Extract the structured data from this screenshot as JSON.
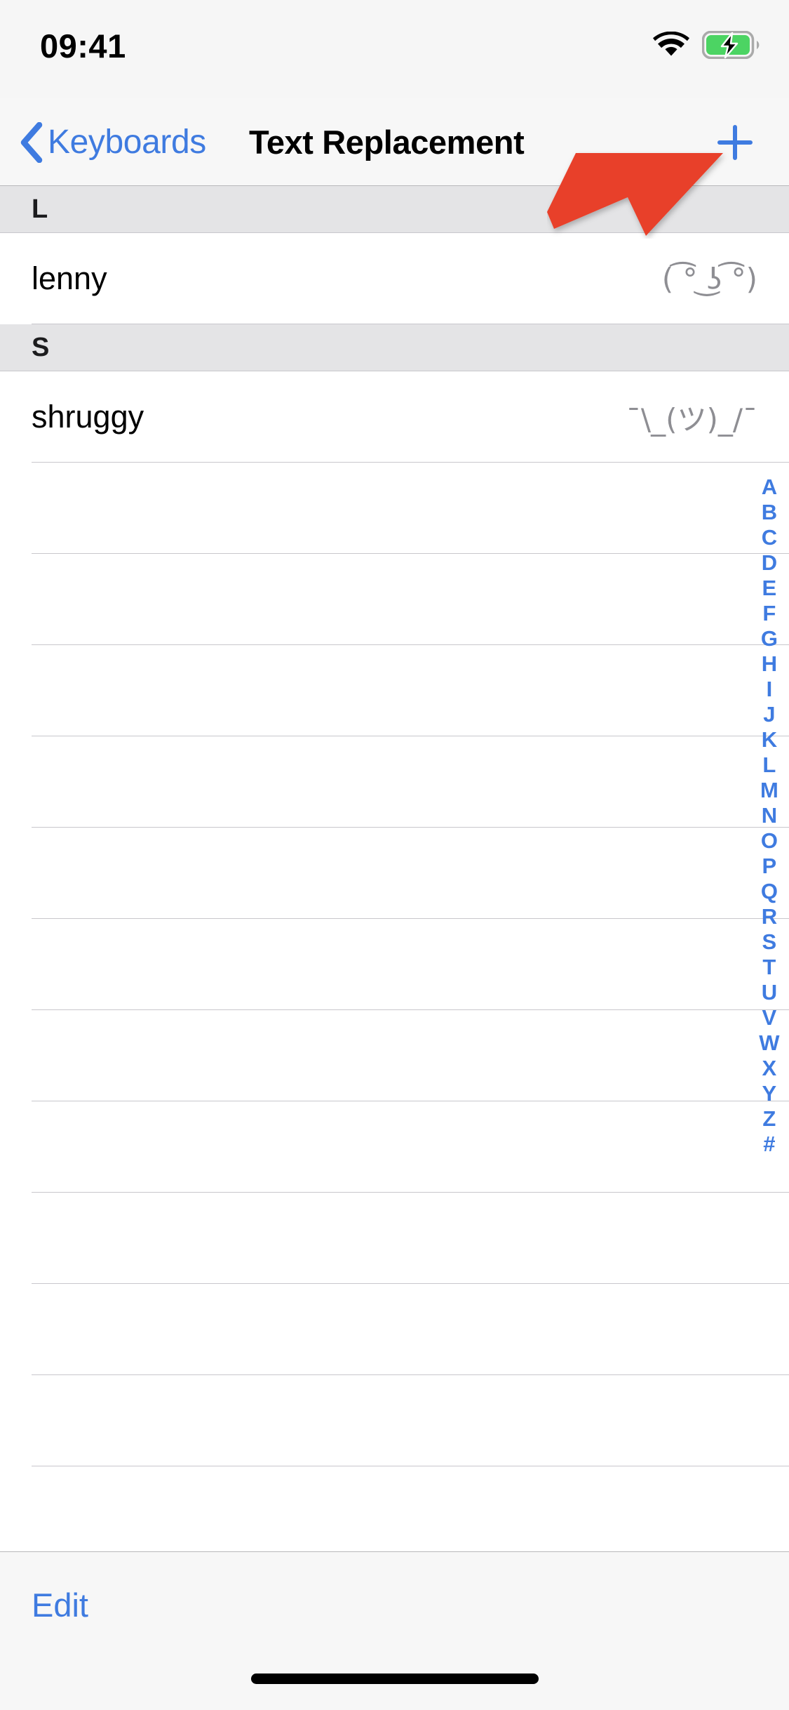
{
  "status_bar": {
    "time": "09:41",
    "wifi_icon": "wifi-icon",
    "battery_icon": "battery-charging-icon",
    "battery_color": "#4CD463"
  },
  "nav_bar": {
    "back_icon": "chevron-left-icon",
    "back_label": "Keyboards",
    "title": "Text Replacement",
    "add_icon": "plus-icon",
    "accent_color": "#3F7BE0"
  },
  "list": {
    "sections": [
      {
        "header": "L",
        "rows": [
          {
            "shortcut": "lenny",
            "phrase": "( ͡° ͜ʖ ͡°)"
          }
        ]
      },
      {
        "header": "S",
        "rows": [
          {
            "shortcut": "shruggy",
            "phrase": "¯\\_(ツ)_/¯"
          }
        ]
      }
    ],
    "empty_row_count": 12
  },
  "index_bar": {
    "letters": [
      "A",
      "B",
      "C",
      "D",
      "E",
      "F",
      "G",
      "H",
      "I",
      "J",
      "K",
      "L",
      "M",
      "N",
      "O",
      "P",
      "Q",
      "R",
      "S",
      "T",
      "U",
      "V",
      "W",
      "X",
      "Y",
      "Z",
      "#"
    ],
    "color": "#3F7BE0"
  },
  "toolbar": {
    "edit_label": "Edit"
  },
  "annotation": {
    "arrow_color": "#E8402A",
    "arrow_name": "red-pointer-arrow",
    "points_to": "plus-icon"
  },
  "home_indicator": {
    "label": "home-indicator"
  }
}
